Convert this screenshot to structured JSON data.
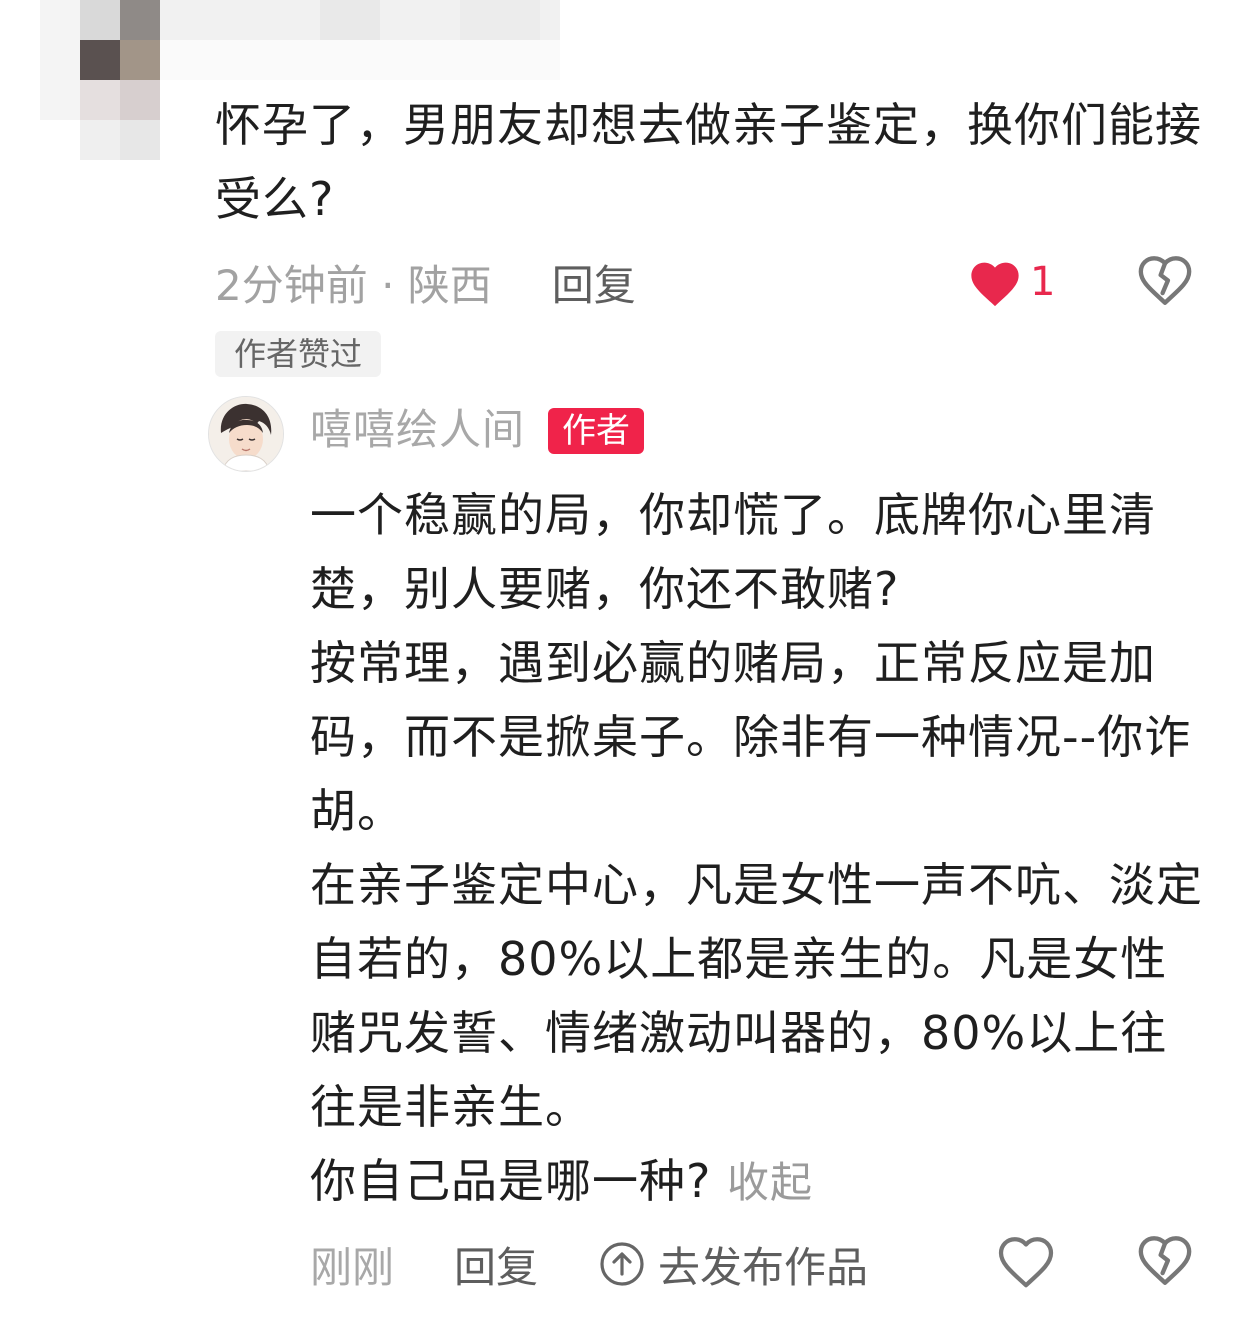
{
  "comment": {
    "text": "怀孕了，男朋友却想去做亲子鉴定，换你们能接受么?",
    "time_location": "2分钟前 · 陕西",
    "reply_label": "回复",
    "like_count": "1",
    "liked_badge": "作者赞过"
  },
  "author_reply": {
    "name": "嘻嘻绘人间",
    "tag": "作者",
    "paragraphs": [
      "一个稳赢的局，你却慌了。底牌你心里清楚，别人要赌，你还不敢赌?",
      "按常理，遇到必赢的赌局，正常反应是加码，而不是掀桌子。除非有一种情况--你诈胡。",
      "在亲子鉴定中心，凡是女性一声不吭、淡定自若的，80%以上都是亲生的。凡是女性赌咒发誓、情绪激动叫器的，80%以上往往是非亲生。",
      "你自己品是哪一种?"
    ],
    "collapse_label": "收起",
    "time": "刚刚",
    "reply_label": "回复",
    "publish_label": "去发布作品"
  },
  "icons": {
    "liked_heart": "heart-filled-icon",
    "heart": "heart-outline-icon",
    "dislike": "broken-heart-icon",
    "publish": "upload-arrow-icon"
  },
  "colors": {
    "accent_red": "#f0234a",
    "heart_red": "#e8284d",
    "muted_gray": "#a2a2a2"
  }
}
